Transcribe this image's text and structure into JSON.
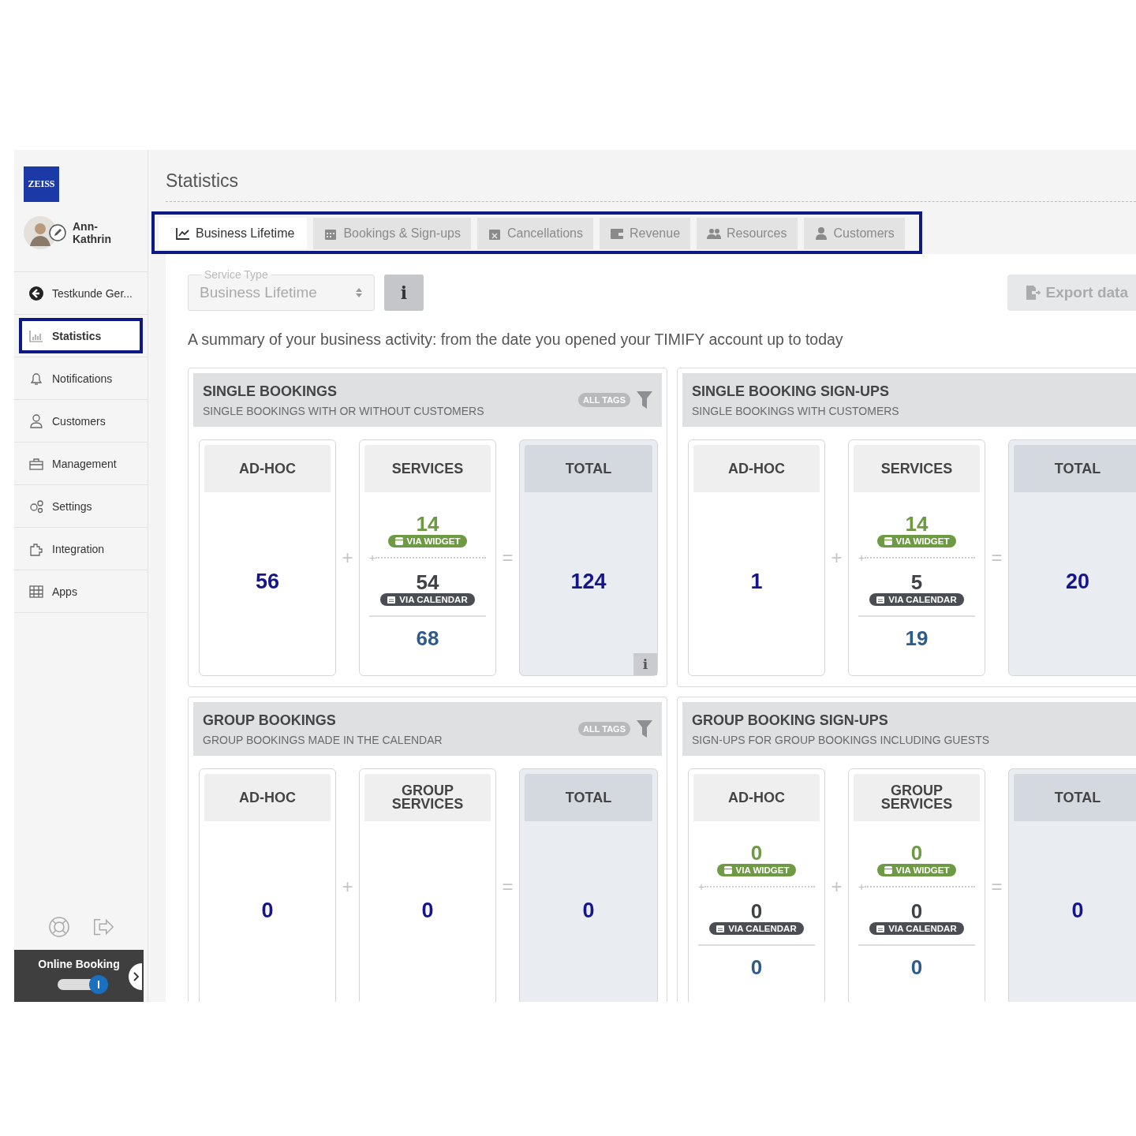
{
  "sidebar": {
    "logo": "ZEISS",
    "user": {
      "name": "Ann-Kathrin"
    },
    "items": [
      {
        "label": "Testkunde Ger...",
        "selected": false,
        "highlighted": false
      },
      {
        "label": "Statistics",
        "selected": true,
        "highlighted": true
      },
      {
        "label": "Notifications",
        "selected": false,
        "highlighted": false
      },
      {
        "label": "Customers",
        "selected": false,
        "highlighted": false
      },
      {
        "label": "Management",
        "selected": false,
        "highlighted": false
      },
      {
        "label": "Settings",
        "selected": false,
        "highlighted": false
      },
      {
        "label": "Integration",
        "selected": false,
        "highlighted": false
      },
      {
        "label": "Apps",
        "selected": false,
        "highlighted": false
      }
    ],
    "online_booking": {
      "label": "Online Booking",
      "on": true
    }
  },
  "main": {
    "title": "Statistics",
    "tabs_highlighted": true,
    "tabs": [
      {
        "label": "Business Lifetime",
        "selected": true
      },
      {
        "label": "Bookings & Sign-ups",
        "selected": false
      },
      {
        "label": "Cancellations",
        "selected": false
      },
      {
        "label": "Revenue",
        "selected": false
      },
      {
        "label": "Resources",
        "selected": false
      },
      {
        "label": "Customers",
        "selected": false
      }
    ],
    "service_type": {
      "label": "Service Type",
      "value": "Business Lifetime",
      "disabled": true
    },
    "info_button": "i",
    "export_button": "Export data",
    "summary": "A summary of your business activity: from the date you opened your TIMIFY account up to today",
    "panels": [
      {
        "title": "SINGLE BOOKINGS",
        "subtitle": "SINGLE BOOKINGS WITH OR WITHOUT CUSTOMERS",
        "tags": "ALL TAGS",
        "filter": true,
        "operators": [
          "+",
          "="
        ],
        "columns": [
          {
            "heading": "AD-HOC",
            "kind": "simple",
            "value": "56"
          },
          {
            "heading": "SERVICES",
            "kind": "split",
            "widget": "14",
            "widget_label": "VIA WIDGET",
            "plus": "+",
            "calendar": "54",
            "calendar_label": "VIA CALENDAR",
            "sum": "68"
          },
          {
            "heading": "TOTAL",
            "kind": "total",
            "value": "124",
            "info": "i"
          }
        ]
      },
      {
        "title": "SINGLE BOOKING SIGN-UPS",
        "subtitle": "SINGLE BOOKINGS WITH CUSTOMERS",
        "operators": [
          "+",
          "="
        ],
        "columns": [
          {
            "heading": "AD-HOC",
            "kind": "simple",
            "value": "1"
          },
          {
            "heading": "SERVICES",
            "kind": "split",
            "widget": "14",
            "widget_label": "VIA WIDGET",
            "plus": "+",
            "calendar": "5",
            "calendar_label": "VIA CALENDAR",
            "sum": "19"
          },
          {
            "heading": "TOTAL",
            "kind": "total",
            "value": "20"
          }
        ]
      },
      {
        "title": "GROUP BOOKINGS",
        "subtitle": "GROUP BOOKINGS MADE IN THE CALENDAR",
        "tags": "ALL TAGS",
        "filter": true,
        "operators": [
          "+",
          "="
        ],
        "columns": [
          {
            "heading": "AD-HOC",
            "kind": "simple",
            "value": "0"
          },
          {
            "heading": "GROUP SERVICES",
            "kind": "simple",
            "value": "0"
          },
          {
            "heading": "TOTAL",
            "kind": "total",
            "value": "0"
          }
        ]
      },
      {
        "title": "GROUP BOOKING SIGN-UPS",
        "subtitle": "SIGN-UPS FOR GROUP BOOKINGS INCLUDING GUESTS",
        "operators": [
          "+",
          "="
        ],
        "columns": [
          {
            "heading": "AD-HOC",
            "kind": "split",
            "widget": "0",
            "widget_label": "VIA WIDGET",
            "plus": "+",
            "calendar": "0",
            "calendar_label": "VIA CALENDAR",
            "sum": "0"
          },
          {
            "heading": "GROUP SERVICES",
            "kind": "split",
            "widget": "0",
            "widget_label": "VIA WIDGET",
            "plus": "+",
            "calendar": "0",
            "calendar_label": "VIA CALENDAR",
            "sum": "0"
          },
          {
            "heading": "TOTAL",
            "kind": "total",
            "value": "0"
          }
        ]
      }
    ]
  }
}
